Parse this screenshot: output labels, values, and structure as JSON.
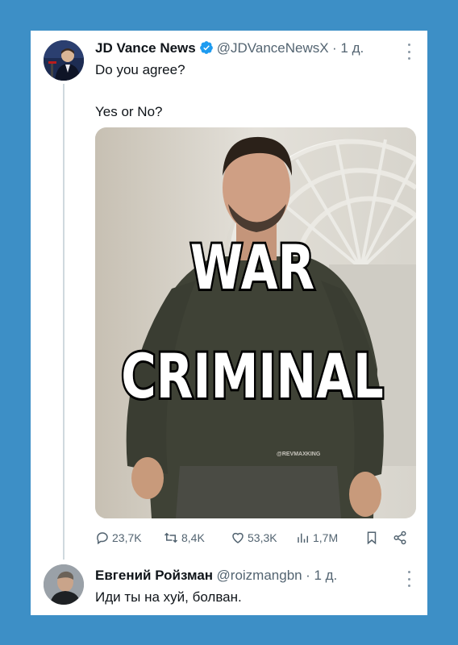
{
  "tweet": {
    "author_name": "JD Vance News",
    "handle": "@JDVanceNewsX",
    "time": "· 1 д.",
    "line1": "Do you agree?",
    "line2": "Yes or No?",
    "image_text_1": "WAR",
    "image_text_2": "CRIMINAL",
    "watermark": "@REVMAXKING",
    "stats": {
      "replies": "23,7K",
      "retweets": "8,4K",
      "likes": "53,3K",
      "views": "1,7M"
    }
  },
  "reply": {
    "author_name": "Евгений Ройзман",
    "handle": "@roizmangbn",
    "time": "· 1 д.",
    "text": "Иди ты на хуй, болван."
  },
  "colors": {
    "background": "#3d8fc6",
    "verified": "#1d9bf0",
    "muted": "#536471"
  },
  "icons": [
    "verified-badge-icon",
    "more-icon",
    "reply-icon",
    "retweet-icon",
    "like-icon",
    "views-icon",
    "bookmark-icon",
    "share-icon"
  ]
}
